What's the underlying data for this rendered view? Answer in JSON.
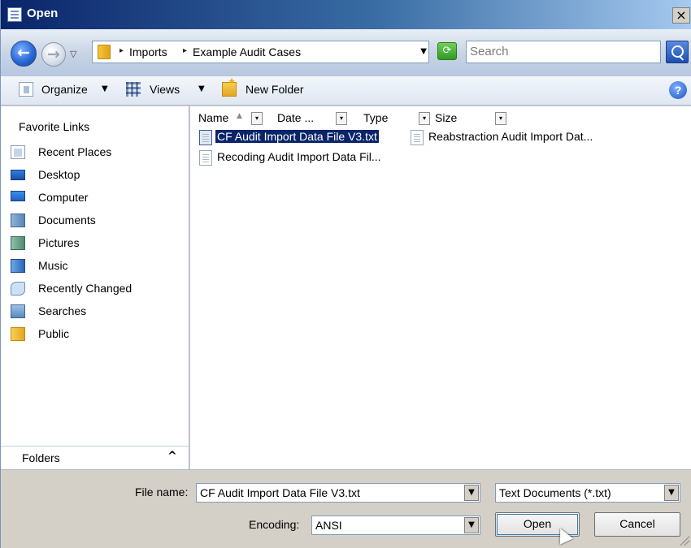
{
  "window": {
    "title": "Open",
    "close_glyph": "×"
  },
  "address": {
    "back_glyph": "←",
    "forward_glyph": "→",
    "history_glyph": "▽",
    "sep_glyph": "▸",
    "crumbs": [
      "Imports",
      "Example Audit Cases"
    ],
    "dropdown_glyph": "▼",
    "refresh_glyph": "⟳",
    "search_placeholder": "Search"
  },
  "toolbar": {
    "organize_label": "Organize",
    "views_label": "Views",
    "new_folder_label": "New Folder",
    "caret": "▼",
    "help_glyph": "?"
  },
  "nav": {
    "heading": "Favorite Links",
    "items": [
      {
        "label": "Recent Places",
        "icon": "recent-places-icon"
      },
      {
        "label": "Desktop",
        "icon": "desktop-icon"
      },
      {
        "label": "Computer",
        "icon": "computer-icon"
      },
      {
        "label": "Documents",
        "icon": "documents-icon"
      },
      {
        "label": "Pictures",
        "icon": "pictures-icon"
      },
      {
        "label": "Music",
        "icon": "music-icon"
      },
      {
        "label": "Recently Changed",
        "icon": "recently-changed-icon"
      },
      {
        "label": "Searches",
        "icon": "searches-icon"
      },
      {
        "label": "Public",
        "icon": "public-folder-icon"
      }
    ],
    "folders_label": "Folders",
    "folders_caret": "^"
  },
  "columns": {
    "name": "Name",
    "sort_glyph": "▲",
    "date": "Date ...",
    "type": "Type",
    "size": "Size",
    "drop_glyph": "▾"
  },
  "files": [
    {
      "name": "CF Audit Import Data File V3.txt",
      "selected": true
    },
    {
      "name": "Reabstraction Audit Import Dat...",
      "selected": false
    },
    {
      "name": "Recoding Audit Import Data Fil...",
      "selected": false
    }
  ],
  "bottom": {
    "file_name_label": "File name:",
    "file_name_value": "CF Audit Import Data File V3.txt",
    "file_type_value": "Text Documents (*.txt)",
    "encoding_label": "Encoding:",
    "encoding_value": "ANSI",
    "combo_glyph": "▼",
    "open_label": "Open",
    "cancel_label": "Cancel"
  },
  "colors": {
    "title_start": "#0a246a",
    "selection": "#0a246a",
    "dialog_face": "#d4d0c8"
  }
}
